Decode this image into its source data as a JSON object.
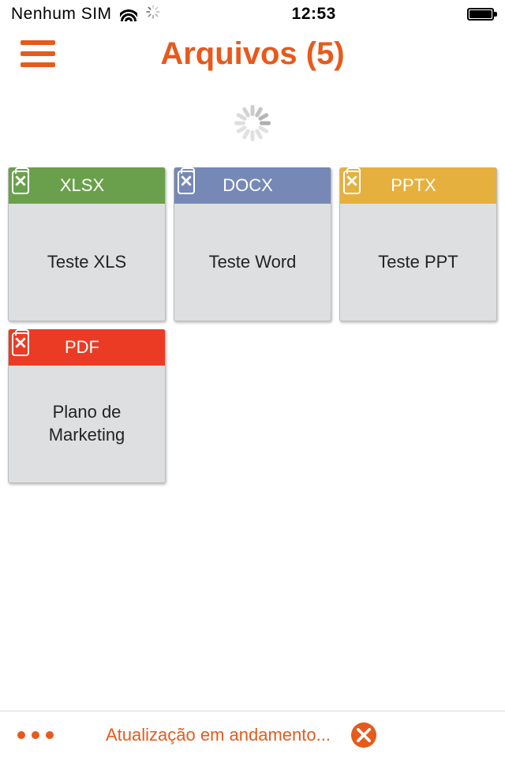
{
  "status_bar": {
    "carrier": "Nenhum SIM",
    "time": "12:53"
  },
  "header": {
    "title": "Arquivos (5)"
  },
  "files": [
    {
      "ext": "XLSX",
      "name": "Teste XLS",
      "color": "green"
    },
    {
      "ext": "DOCX",
      "name": "Teste Word",
      "color": "blue"
    },
    {
      "ext": "PPTX",
      "name": "Teste PPT",
      "color": "yellow"
    },
    {
      "ext": "PDF",
      "name": "Plano de Marketing",
      "color": "red"
    }
  ],
  "footer": {
    "message": "Atualização em andamento..."
  }
}
